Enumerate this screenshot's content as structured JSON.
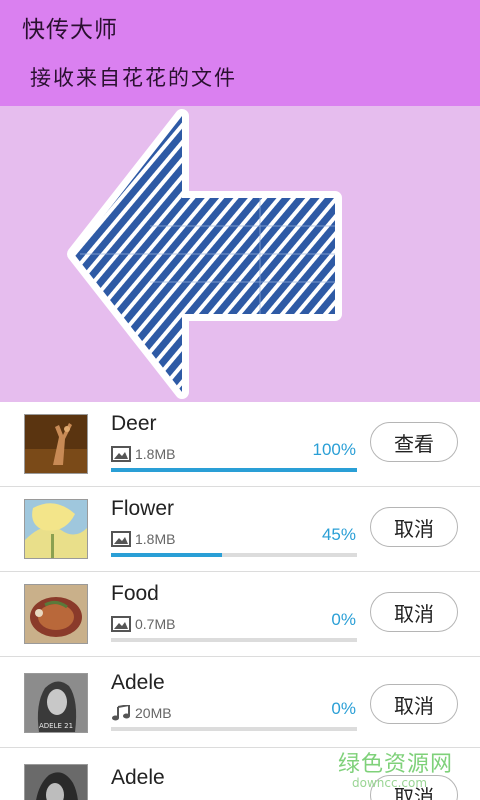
{
  "header": {
    "app_title": "快传大师",
    "subtitle": "接收来自花花的文件"
  },
  "banner": {
    "icon": "big-left-arrow-icon",
    "color": "#2e5aa5"
  },
  "files": [
    {
      "name": "Deer",
      "type": "image",
      "size": "1.8MB",
      "progress_percent": 100,
      "progress_text": "100%",
      "action": "查看",
      "thumb": "deer"
    },
    {
      "name": "Flower",
      "type": "image",
      "size": "1.8MB",
      "progress_percent": 45,
      "progress_text": "45%",
      "action": "取消",
      "thumb": "flower"
    },
    {
      "name": "Food",
      "type": "image",
      "size": "0.7MB",
      "progress_percent": 0,
      "progress_text": "0%",
      "action": "取消",
      "thumb": "food"
    },
    {
      "name": "Adele",
      "type": "music",
      "size": "20MB",
      "progress_percent": 0,
      "progress_text": "0%",
      "action": "取消",
      "thumb": "adele"
    },
    {
      "name": "Adele",
      "type": "music",
      "size": "",
      "progress_percent": 0,
      "progress_text": "",
      "action": "取消",
      "thumb": "adele2"
    }
  ],
  "colors": {
    "header": "#da80f0",
    "banner": "#e6bdee",
    "accent": "#2a9fd6"
  },
  "watermark": {
    "main": "绿色资源网",
    "sub": "downcc.com"
  }
}
